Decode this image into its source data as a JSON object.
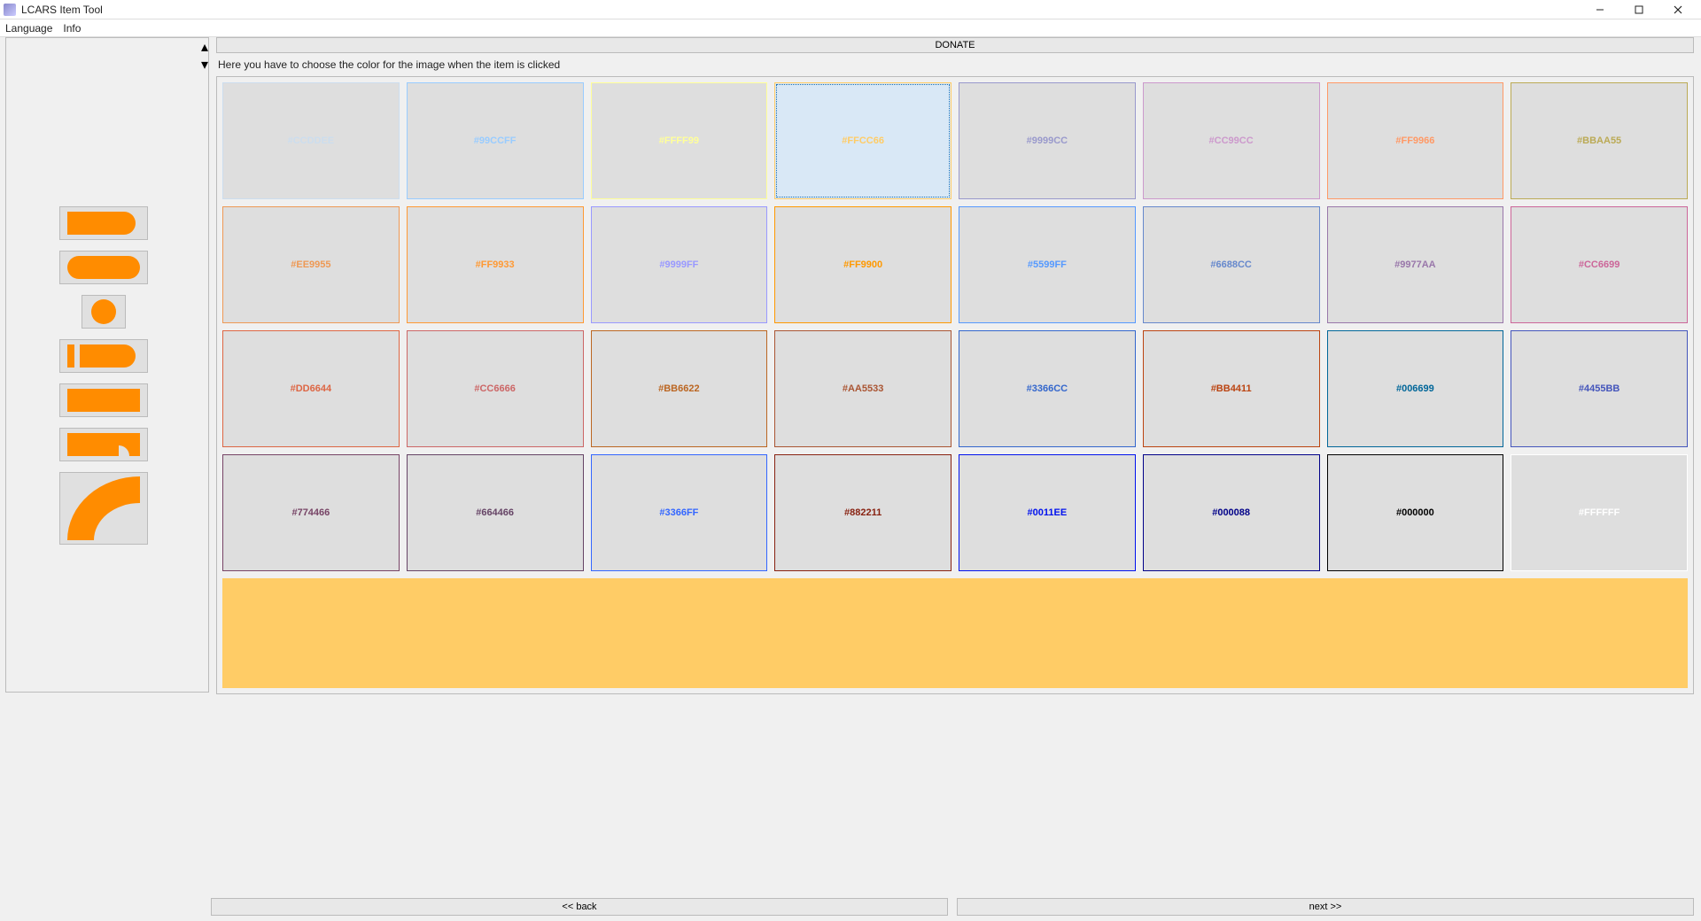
{
  "window": {
    "title": "LCARS Item Tool"
  },
  "menu": {
    "language": "Language",
    "info": "Info"
  },
  "donate_label": "DONATE",
  "instruction": "Here you have to choose the color for the image when the item is clicked",
  "colors": [
    [
      "#CCDDEE",
      "#99CCFF",
      "#FFFF99",
      "#FFCC66",
      "#9999CC",
      "#CC99CC",
      "#FF9966",
      "#BBAA55"
    ],
    [
      "#EE9955",
      "#FF9933",
      "#9999FF",
      "#FF9900",
      "#5599FF",
      "#6688CC",
      "#9977AA",
      "#CC6699"
    ],
    [
      "#DD6644",
      "#CC6666",
      "#BB6622",
      "#AA5533",
      "#3366CC",
      "#BB4411",
      "#006699",
      "#4455BB"
    ],
    [
      "#774466",
      "#664466",
      "#3366FF",
      "#882211",
      "#0011EE",
      "#000088",
      "#000000",
      "#FFFFFF"
    ]
  ],
  "selected_row": 0,
  "selected_col": 3,
  "nav": {
    "back": "<< back",
    "next": "next >>"
  }
}
